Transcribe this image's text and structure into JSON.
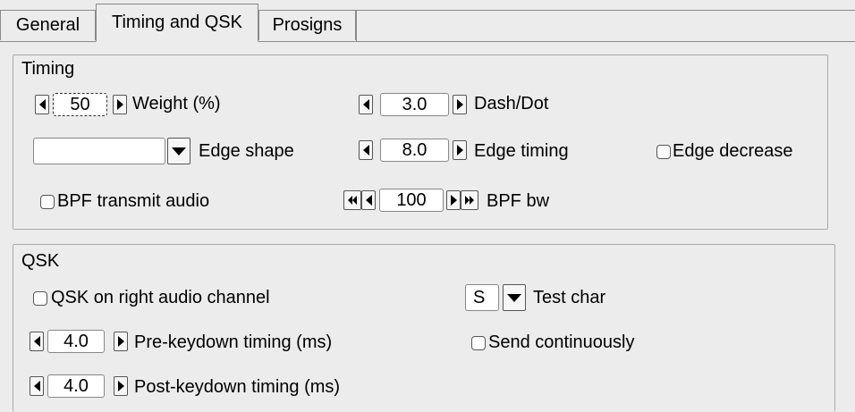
{
  "tabs": [
    {
      "label": "General"
    },
    {
      "label": "Timing and QSK"
    },
    {
      "label": "Prosigns"
    }
  ],
  "timing": {
    "title": "Timing",
    "weight": {
      "value": "50",
      "label": "Weight (%)"
    },
    "dashdot": {
      "value": "3.0",
      "label": "Dash/Dot"
    },
    "edge_shape": {
      "value": "",
      "label": "Edge shape"
    },
    "edge_timing": {
      "value": "8.0",
      "label": "Edge timing"
    },
    "edge_decrease": {
      "label": "Edge decrease",
      "checked": false
    },
    "bpf_transmit": {
      "label": "BPF transmit audio",
      "checked": false
    },
    "bpf_bw": {
      "value": "100",
      "label": "BPF bw"
    }
  },
  "qsk": {
    "title": "QSK",
    "right_channel": {
      "label": "QSK on right audio channel",
      "checked": false
    },
    "test_char": {
      "value": "S",
      "label": "Test char"
    },
    "pre_keydown": {
      "value": "4.0",
      "label": "Pre-keydown timing (ms)"
    },
    "send_continuously": {
      "label": "Send continuously",
      "checked": false
    },
    "post_keydown": {
      "value": "4.0",
      "label": "Post-keydown timing (ms)"
    }
  }
}
